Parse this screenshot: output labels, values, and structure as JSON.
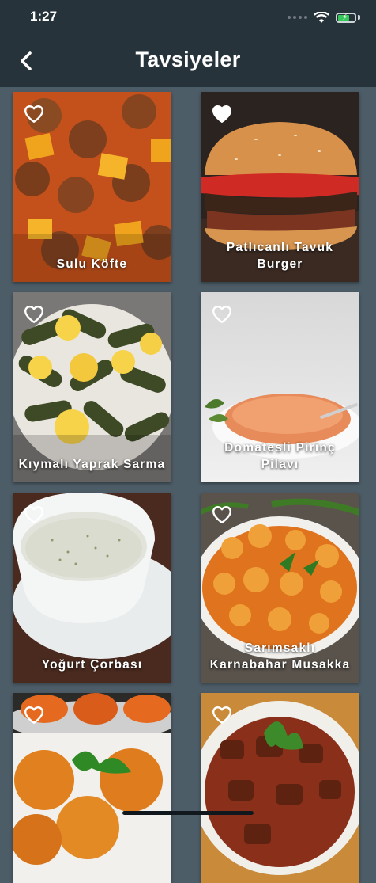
{
  "status_bar": {
    "time": "1:27"
  },
  "header": {
    "title": "Tavsiyeler"
  },
  "recipes": [
    {
      "name": "Sulu Köfte",
      "favorited": false
    },
    {
      "name": "Patlıcanlı Tavuk Burger",
      "favorited": true
    },
    {
      "name": "Kıymalı Yaprak Sarma",
      "favorited": false
    },
    {
      "name": "Domatesli Pirinç Pilavı",
      "favorited": false
    },
    {
      "name": "Yoğurt Çorbası",
      "favorited": false
    },
    {
      "name": "Sarımsaklı Karnabahar Musakka",
      "favorited": false
    },
    {
      "name": "",
      "favorited": false
    },
    {
      "name": "",
      "favorited": false
    }
  ]
}
